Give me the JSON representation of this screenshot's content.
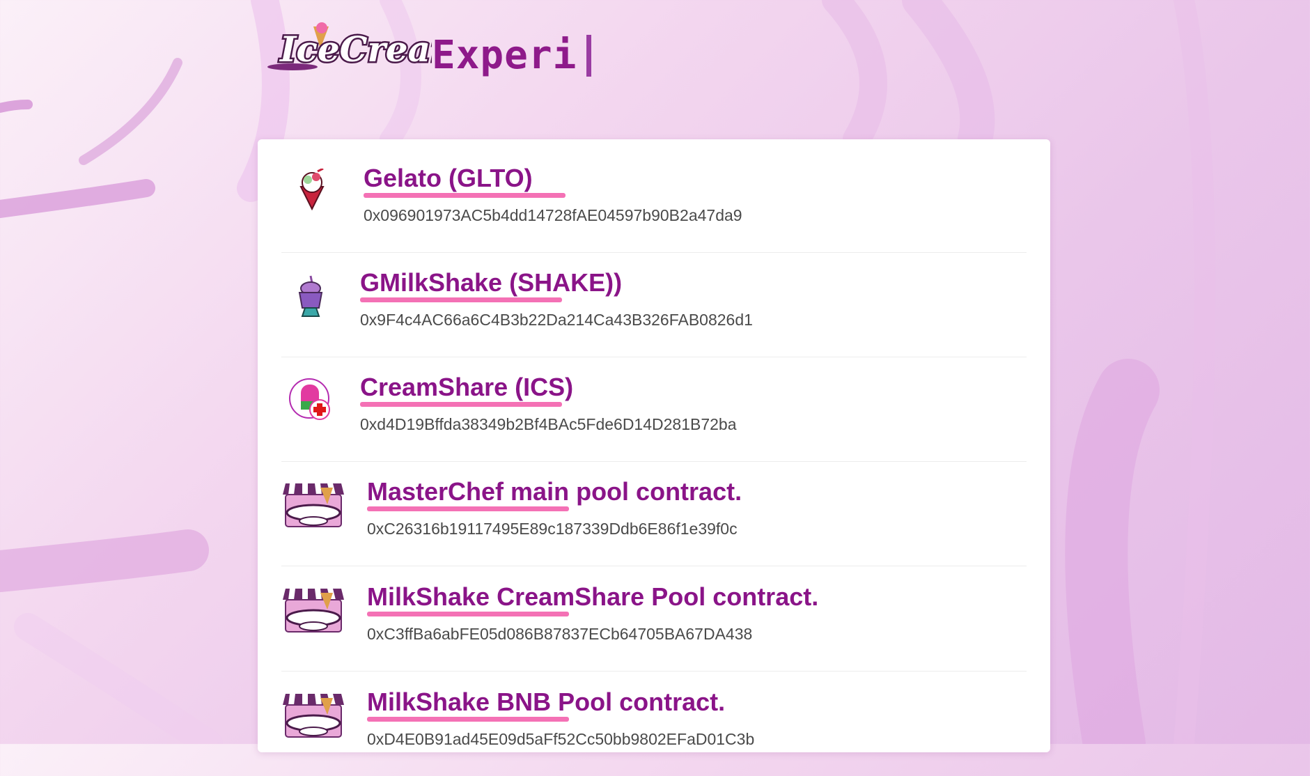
{
  "header": {
    "logo_text": "IceCream",
    "typed_text": "Experi"
  },
  "colors": {
    "brand_purple": "#8a1488",
    "underline_pink": "#f471b5",
    "address_gray": "#4a4a4a"
  },
  "contracts": [
    {
      "name": "Gelato (GLTO)",
      "address": "0x096901973AC5b4dd14728fAE04597b90B2a47da9",
      "icon": "gelato-icon"
    },
    {
      "name": "GMilkShake (SHAKE))",
      "address": "0x9F4c4AC66a6C4B3b22Da214Ca43B326FAB0826d1",
      "icon": "milkshake-icon"
    },
    {
      "name": "CreamShare (ICS)",
      "address": "0xd4D19Bffda38349b2Bf4BAc5Fde6D14D281B72ba",
      "icon": "creamshare-icon"
    },
    {
      "name": "MasterChef main pool contract.",
      "address": "0xC26316b19117495E89c187339Ddb6E86f1e39f0c",
      "icon": "icecream-farms-icon"
    },
    {
      "name": "MilkShake CreamShare Pool contract.",
      "address": "0xC3ffBa6abFE05d086B87837ECb64705BA67DA438",
      "icon": "icecream-farms-icon"
    },
    {
      "name": "MilkShake BNB Pool contract.",
      "address": "0xD4E0B91ad45E09d5aFf52Cc50bb9802EFaD01C3b",
      "icon": "icecream-farms-icon"
    }
  ]
}
